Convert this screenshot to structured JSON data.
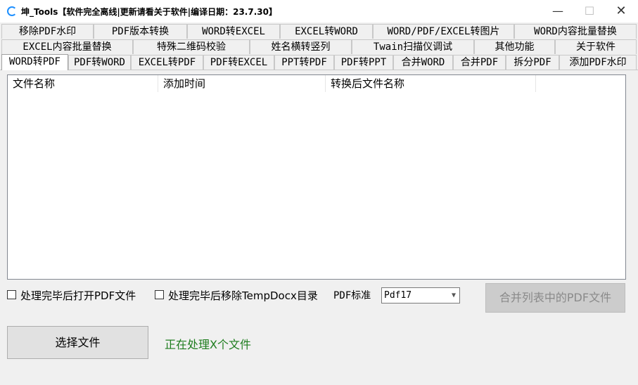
{
  "window": {
    "title": "坤_Tools【软件完全离线|更新请看关于软件|编译日期：23.7.30】",
    "minimize": "—",
    "maximize": "☐",
    "close": "✕"
  },
  "tabs_row1": [
    "移除PDF水印",
    "PDF版本转换",
    "WORD转EXCEL",
    "EXCEL转WORD",
    "WORD/PDF/EXCEL转图片",
    "WORD内容批量替换"
  ],
  "tabs_row2": [
    "EXCEL内容批量替换",
    "特殊二维码校验",
    "姓名横转竖列",
    "Twain扫描仪调试",
    "其他功能",
    "关于软件"
  ],
  "tabs_row3": [
    "WORD转PDF",
    "PDF转WORD",
    "EXCEL转PDF",
    "PDF转EXCEL",
    "PPT转PDF",
    "PDF转PPT",
    "合并WORD",
    "合并PDF",
    "拆分PDF",
    "添加PDF水印"
  ],
  "list": {
    "columns": [
      "文件名称",
      "添加时间",
      "转换后文件名称"
    ]
  },
  "options": {
    "open_after": "处理完毕后打开PDF文件",
    "remove_temp": "处理完毕后移除TempDocx目录",
    "pdf_standard_label": "PDF标准",
    "pdf_standard_value": "Pdf17"
  },
  "buttons": {
    "merge": "合并列表中的PDF文件",
    "select_files": "选择文件"
  },
  "status": "正在处理X个文件",
  "colors": {
    "status_green": "#1e7d1e",
    "icon_blue": "#1e90ff"
  }
}
